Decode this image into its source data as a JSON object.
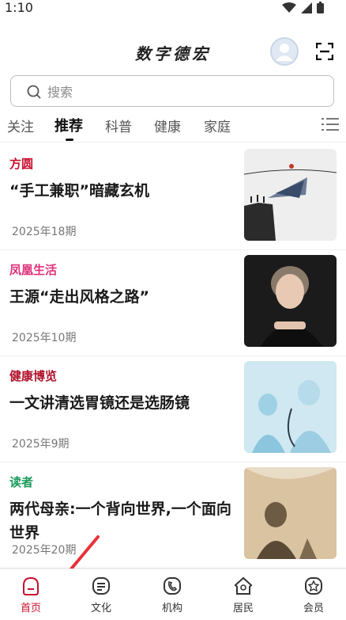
{
  "status_bar": {
    "time": "1:10"
  },
  "header": {
    "title": "数字德宏",
    "avatar_icon": "user-avatar",
    "scan_icon": "scan-icon"
  },
  "search": {
    "placeholder": "搜索"
  },
  "tabs": [
    {
      "label": "关注",
      "active": false
    },
    {
      "label": "推荐",
      "active": true
    },
    {
      "label": "科普",
      "active": false
    },
    {
      "label": "健康",
      "active": false
    },
    {
      "label": "家庭",
      "active": false
    }
  ],
  "feed": [
    {
      "source": "方圆",
      "source_color": "#c8102e",
      "title": "“手工兼职”暗藏玄机",
      "issue": "2025年18期"
    },
    {
      "source": "凤凰生活",
      "source_color": "#e0307a",
      "title": "王源“走出风格之路”",
      "issue": "2025年10期"
    },
    {
      "source": "健康博览",
      "source_color": "#b0102a",
      "title": "一文讲清选胃镜还是选肠镜",
      "issue": "2025年9期"
    },
    {
      "source": "读者",
      "source_color": "#1a9a5a",
      "title": "两代母亲:一个背向世界,一个面向世界",
      "issue": "2025年20期"
    }
  ],
  "bottom_nav": [
    {
      "label": "首页",
      "icon": "home-icon",
      "active": true
    },
    {
      "label": "文化",
      "icon": "culture-icon",
      "active": false
    },
    {
      "label": "机构",
      "icon": "organization-icon",
      "active": false
    },
    {
      "label": "居民",
      "icon": "residents-icon",
      "active": false
    },
    {
      "label": "会员",
      "icon": "member-icon",
      "active": false
    }
  ],
  "colors": {
    "accent": "#c8102e",
    "arrow": "#e8323a"
  }
}
